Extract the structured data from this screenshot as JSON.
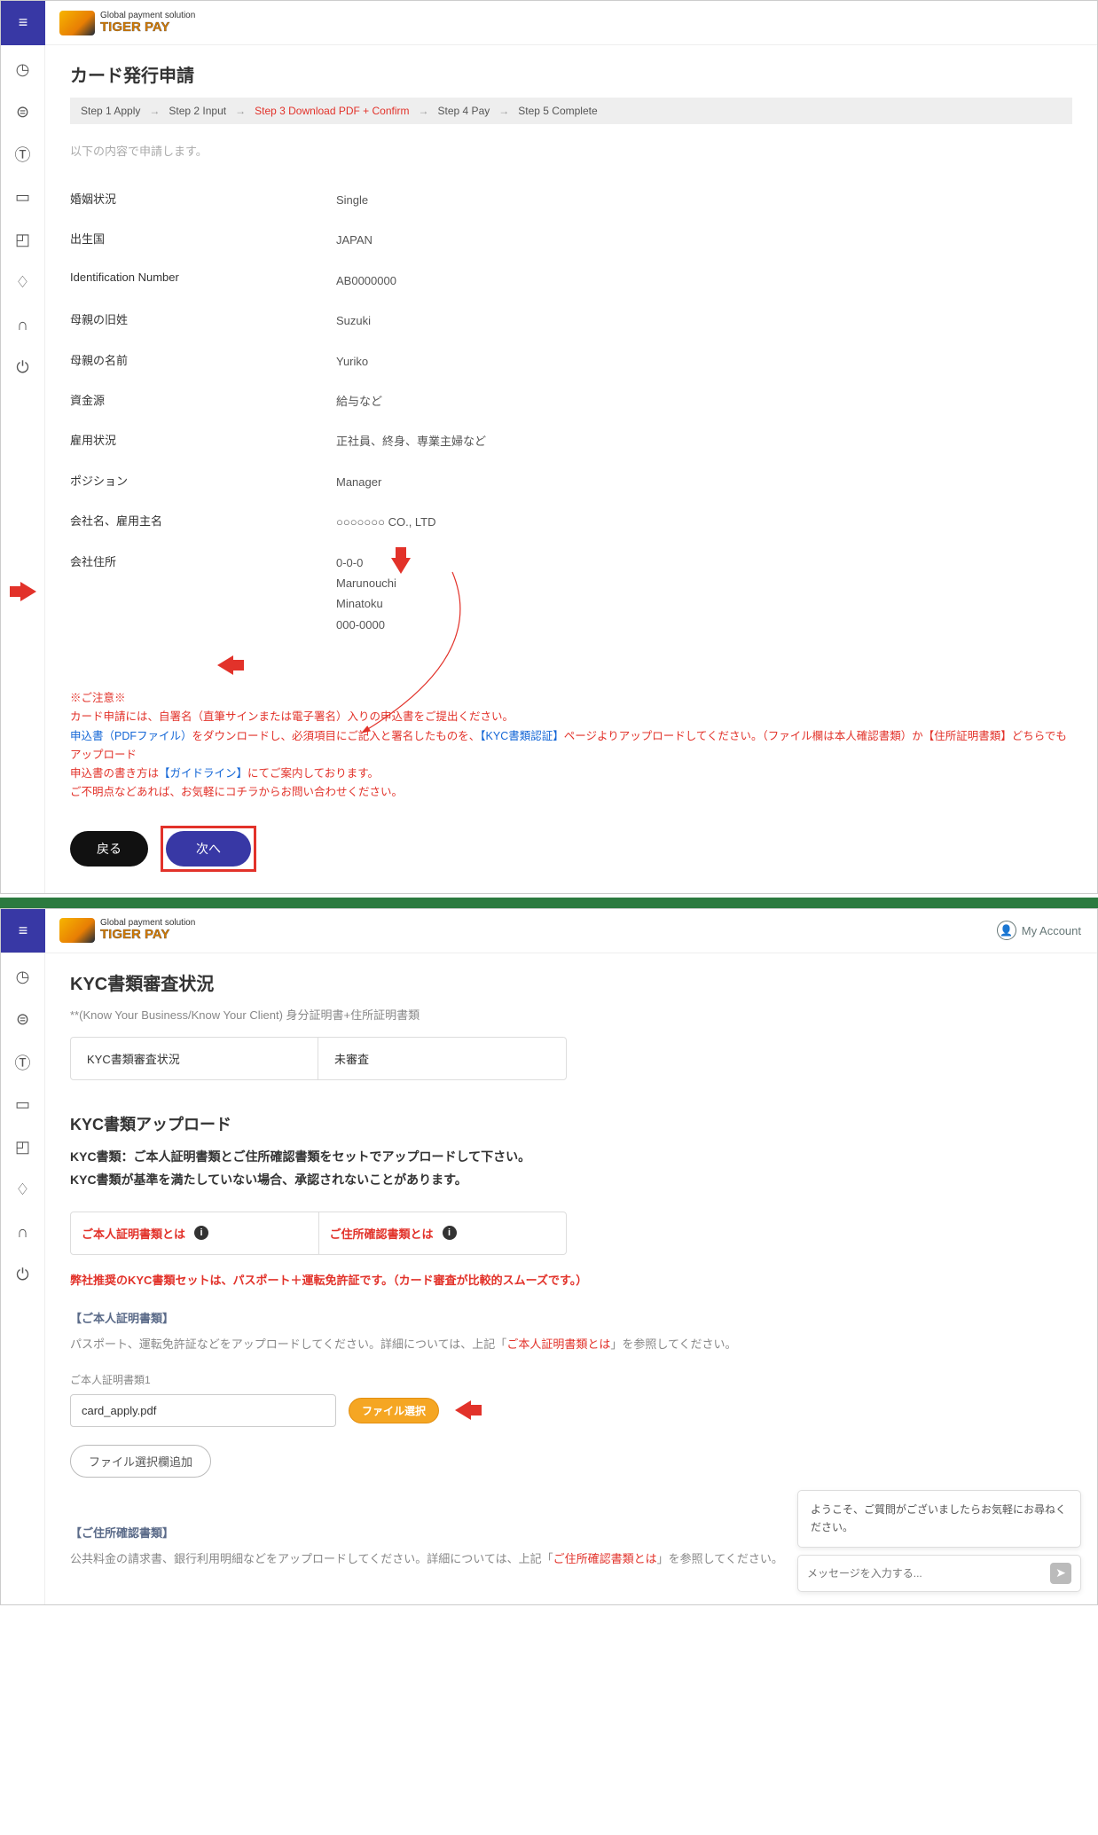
{
  "logo": {
    "tagline": "Global payment solution",
    "brand": "TIGER PAY"
  },
  "sidebar": {
    "items": [
      "clock",
      "yen",
      "top",
      "card",
      "box",
      "bell",
      "headset",
      "power"
    ]
  },
  "page1": {
    "title": "カード発行申請",
    "steps": {
      "s1": "Step 1 Apply",
      "s2": "Step 2 Input",
      "s3": "Step 3 Download PDF + Confirm",
      "s4": "Step 4 Pay",
      "s5": "Step 5 Complete"
    },
    "intro": "以下の内容で申請します。",
    "fields": {
      "marital": {
        "label": "婚姻状況",
        "val": "Single"
      },
      "birth_country": {
        "label": "出生国",
        "val": "JAPAN"
      },
      "idnum": {
        "label": "Identification Number",
        "val": "AB0000000"
      },
      "mother_maiden": {
        "label": "母親の旧姓",
        "val": "Suzuki"
      },
      "mother_name": {
        "label": "母親の名前",
        "val": "Yuriko"
      },
      "income": {
        "label": "資金源",
        "val": "給与など"
      },
      "employment": {
        "label": "雇用状況",
        "val": "正社員、終身、専業主婦など"
      },
      "position": {
        "label": "ポジション",
        "val": "Manager"
      },
      "company": {
        "label": "会社名、雇用主名",
        "val": "○○○○○○○ CO., LTD"
      },
      "company_addr": {
        "label": "会社住所",
        "val": "0-0-0\nMarunouchi\nMinatoku\n000-0000"
      }
    },
    "notice": {
      "head1": "※ご注意※",
      "head2": "カード申請には、自署名（直筆サインまたは電子署名）入りの申込書をご提出ください。",
      "line2a": "申込書（PDFファイル）",
      "line2b": "をダウンロードし、必須項目にご記入と署名したものを、",
      "line2c": "【KYC書類認証】",
      "line2d": "ページよりアップロードしてください。（ファイル欄は本人確認書類）か【住所証明書類】どちらでもアップロード",
      "line3a": "申込書の書き方は",
      "line3b": "【ガイドライン】",
      "line3c": "にてご案内しております。",
      "line4": "ご不明点などあれば、お気軽にコチラからお問い合わせください。"
    },
    "buttons": {
      "back": "戻る",
      "next": "次へ"
    }
  },
  "page2": {
    "myaccount": "My Account",
    "title": "KYC書類審査状況",
    "subtext": "**(Know Your Business/Know Your Client) 身分証明書+住所証明書類",
    "status": {
      "label": "KYC書類審査状況",
      "val": "未審査"
    },
    "section2": "KYC書類アップロード",
    "note1": "KYC書類：ご本人証明書類とご住所確認書類をセットでアップロードして下さい。",
    "note2": "KYC書類が基準を満たしていない場合、承認されないことがあります。",
    "tabs": {
      "t1": "ご本人証明書類とは",
      "t2": "ご住所確認書類とは"
    },
    "recommend": "弊社推奨のKYC書類セットは、パスポート＋運転免許証です。（カード審査が比較的スムーズです。）",
    "id_section": {
      "head": "【ご本人証明書類】",
      "desc1": "パスポート、運転免許証などをアップロードしてください。詳細については、上記「",
      "desc_link": "ご本人証明書類とは",
      "desc2": "」を参照してください。",
      "field_label": "ご本人証明書類1",
      "filename": "card_apply.pdf",
      "file_btn": "ファイル選択",
      "add_slot": "ファイル選択欄追加"
    },
    "addr_section": {
      "head": "【ご住所確認書類】",
      "desc1": "公共料金の請求書、銀行利用明細などをアップロードしてください。詳細については、上記「",
      "desc_link": "ご住所確認書類とは",
      "desc2": "」を参照してください。"
    },
    "chat": {
      "greeting": "ようこそ、ご質問がございましたらお気軽にお尋ねください。",
      "placeholder": "メッセージを入力する..."
    }
  }
}
